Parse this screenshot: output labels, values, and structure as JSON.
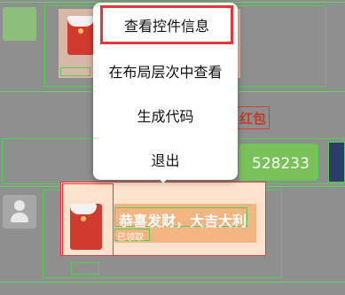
{
  "menu": {
    "items": [
      {
        "label": "查看控件信息"
      },
      {
        "label": "在布局层次中查看"
      },
      {
        "label": "生成代码"
      },
      {
        "label": "退出"
      }
    ]
  },
  "chat": {
    "system_tip": "红包",
    "code_message": "528233",
    "envelope": {
      "title": "恭喜发财，大吉大利",
      "status": "已领取"
    }
  },
  "colors": {
    "highlight_red": "#e8353a",
    "bounds_green": "#4fd04f"
  }
}
